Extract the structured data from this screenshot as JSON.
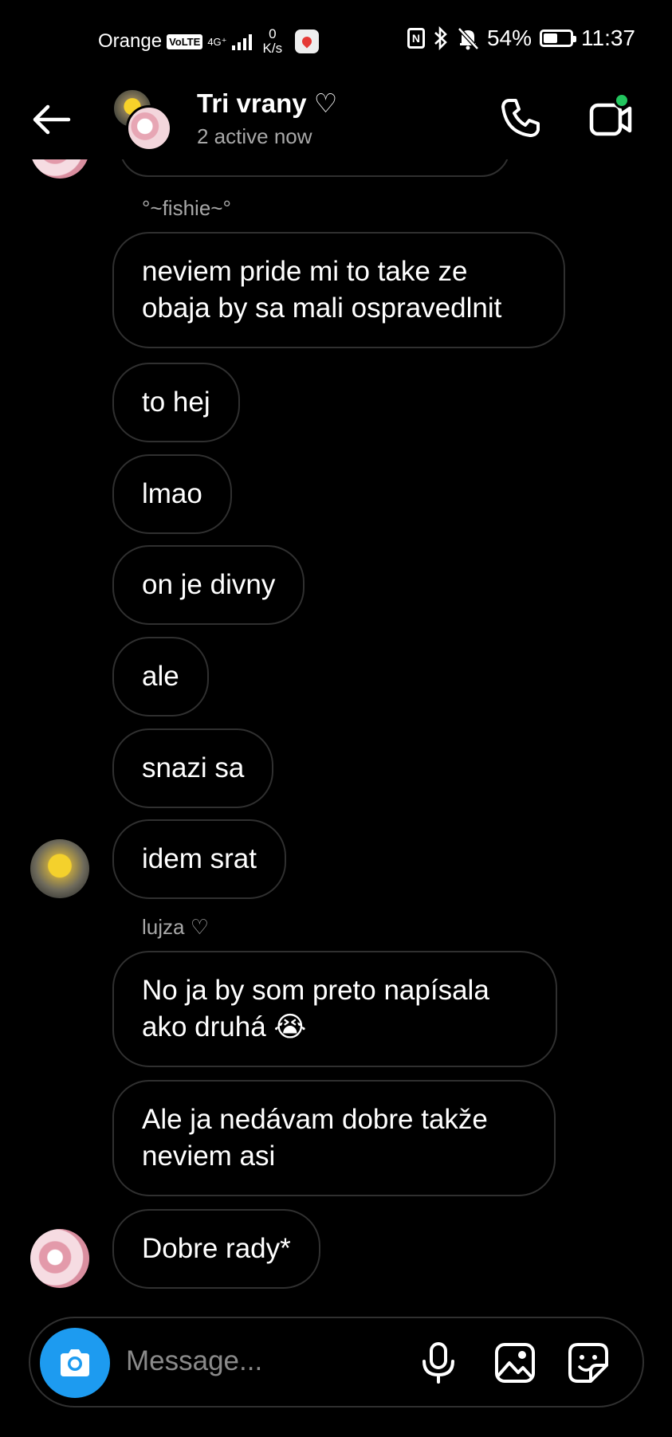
{
  "status_bar": {
    "carrier": "Orange",
    "volte": "VoLTE",
    "network": "4G⁺",
    "data_rate_value": "0",
    "data_rate_unit": "K/s",
    "battery_text": "54%",
    "battery_level": 0.54,
    "time": "11:37"
  },
  "header": {
    "title": "Tri vrany ♡",
    "subtitle": "2 active now"
  },
  "messages": [
    {
      "sender_label": "°~fishie~°"
    },
    {
      "text": "neviem pride mi to take ze\nobaja by sa mali ospravedlnit"
    },
    {
      "text": "to hej"
    },
    {
      "text": "lmao"
    },
    {
      "text": "on je divny"
    },
    {
      "text": "ale"
    },
    {
      "text": "snazi sa"
    },
    {
      "text": "idem srat"
    },
    {
      "sender_label": "lujza ♡"
    },
    {
      "text": "No ja by som preto napísala\nako druhá 😭"
    },
    {
      "text": "Ale ja nedávam dobre takže\nneviem asi"
    },
    {
      "text": "Dobre rady*"
    }
  ],
  "composer": {
    "placeholder": "Message..."
  },
  "colors": {
    "background": "#000000",
    "bubble_border": "#303030",
    "secondary_text": "#a8a8a8",
    "camera_button": "#1d9bf0",
    "online_dot": "#22c55e"
  }
}
